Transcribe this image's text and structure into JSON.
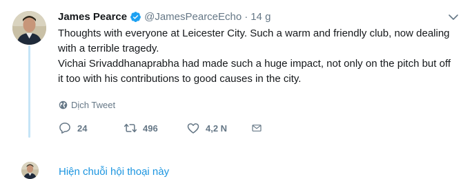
{
  "tweet": {
    "author_name": "James Pearce",
    "handle": "@JamesPearceEcho",
    "separator": "·",
    "time": "14 g",
    "text_line_1": "Thoughts with everyone at Leicester City. Such a warm and friendly club, now dealing with a terrible tragedy.",
    "text_line_2": "Vichai Srivaddhanaprabha had made such a huge impact, not only on the pitch but off it too with his contributions to good causes in the city.",
    "translate_label": "Dịch Tweet",
    "reply_count": "24",
    "retweet_count": "496",
    "like_count": "4,2 N",
    "show_thread_label": "Hiện chuỗi hội thoại này"
  },
  "icons": {
    "verified": "verified-badge-icon",
    "caret": "chevron-down-icon",
    "globe": "globe-icon",
    "reply": "reply-icon",
    "retweet": "retweet-icon",
    "like": "heart-icon",
    "dm": "envelope-icon"
  },
  "colors": {
    "accent": "#1b95e0",
    "verified": "#1da1f2",
    "muted": "#657786",
    "thread_line": "#c5e4f7",
    "text": "#14171a"
  }
}
